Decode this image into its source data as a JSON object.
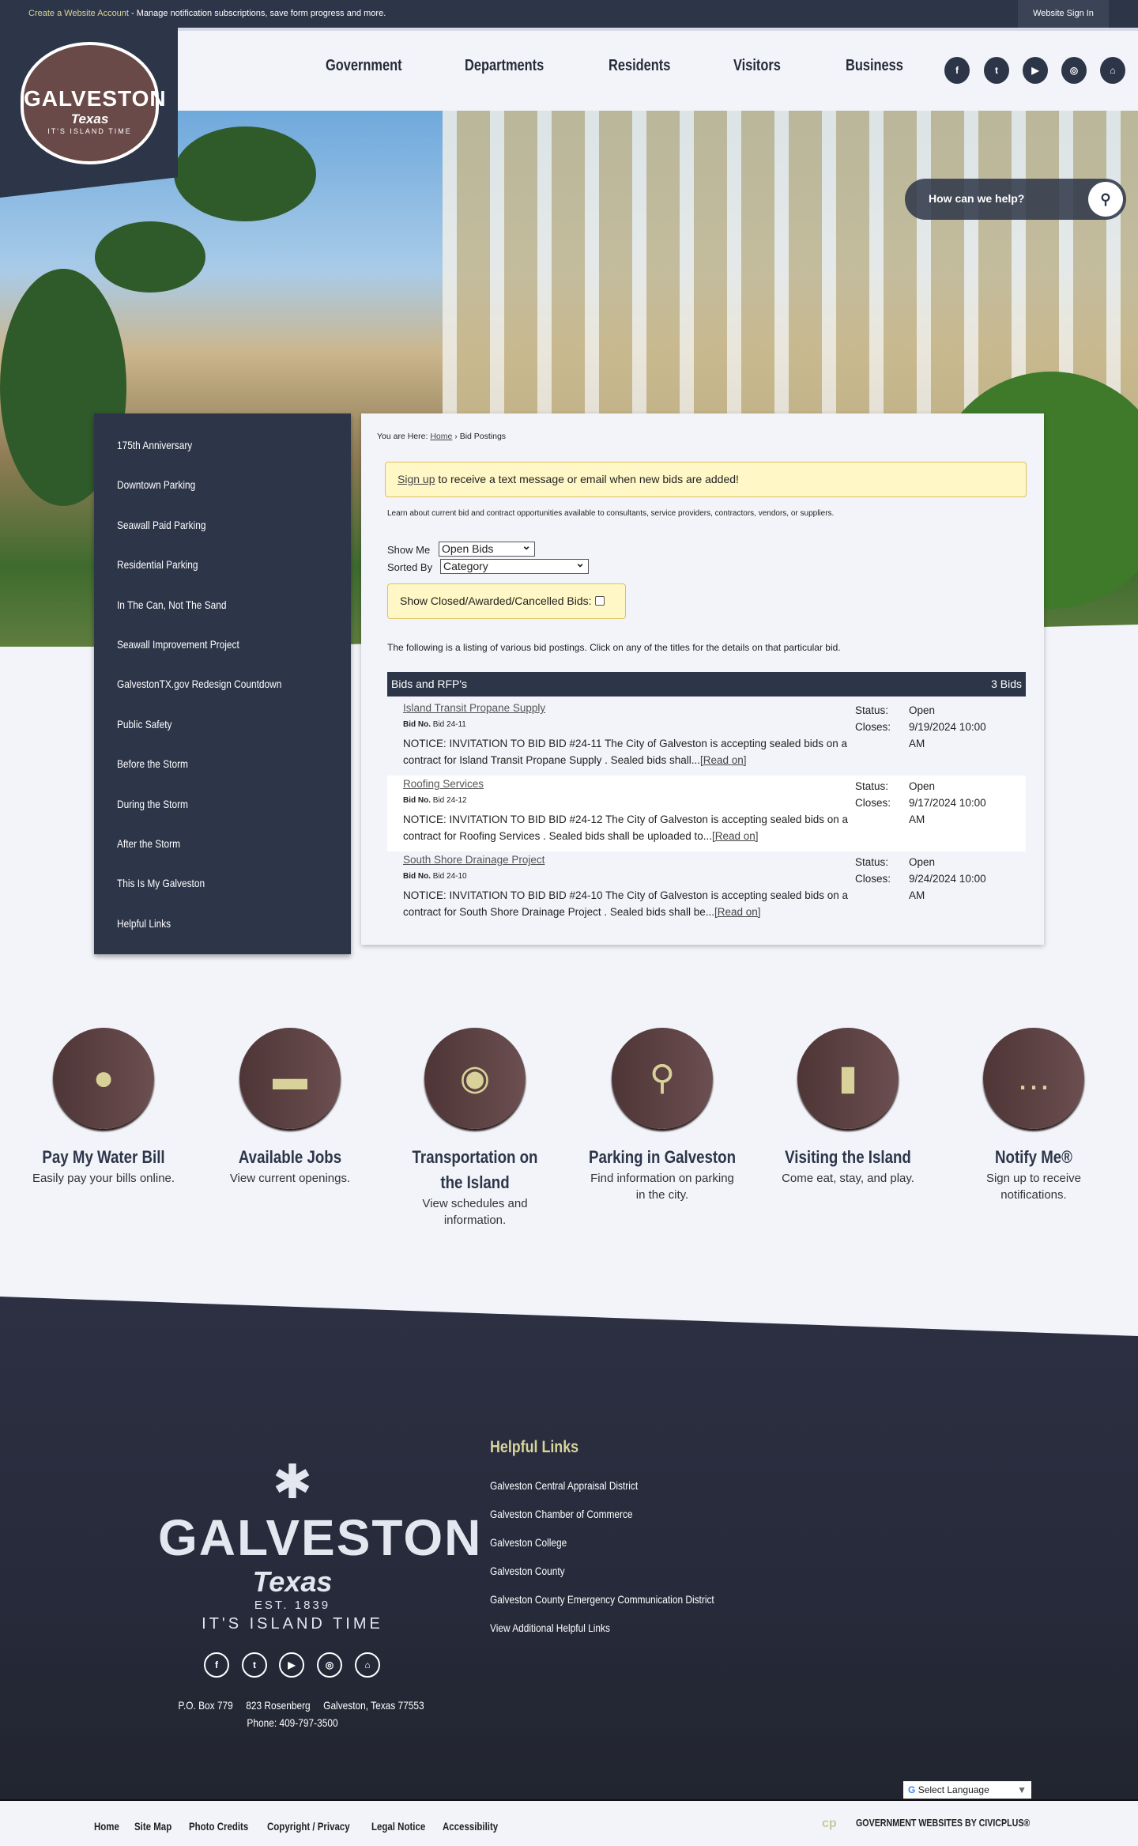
{
  "topbar": {
    "account_link": "Create a Website Account",
    "account_msg": " - Manage notification subscriptions, save form progress and more.",
    "sign_in": "Website Sign In"
  },
  "logo": {
    "name": "GALVESTON",
    "state": "Texas",
    "est": "EST. 1839",
    "tagline": "IT'S ISLAND TIME"
  },
  "nav": {
    "items": [
      "Government",
      "Departments",
      "Residents",
      "Visitors",
      "Business"
    ]
  },
  "social": {
    "icons": [
      "facebook-icon",
      "twitter-icon",
      "youtube-icon",
      "instagram-icon",
      "home-icon"
    ]
  },
  "search": {
    "placeholder": "How can we help?"
  },
  "sidebar": {
    "items": [
      "175th Anniversary",
      "Downtown Parking",
      "Seawall Paid Parking",
      "Residential Parking",
      "In The Can, Not The Sand",
      "Seawall Improvement Project",
      "GalvestonTX.gov Redesign Countdown",
      "Public Safety",
      "Before the Storm",
      "During the Storm",
      "After the Storm",
      "This Is My Galveston",
      "Helpful Links"
    ]
  },
  "content": {
    "breadcrumb": {
      "prefix": "You are Here: ",
      "home": "Home",
      "sep": " › ",
      "current": "Bid Postings"
    },
    "notice": {
      "link": "Sign up",
      "text": " to receive a text message or email when new bids are added!"
    },
    "intro": "Learn about current bid and contract opportunities available to consultants, service providers, contractors, vendors, or suppliers.",
    "show_me_label": "Show Me",
    "show_me_value": "Open Bids",
    "sorted_by_label": "Sorted By",
    "sorted_by_value": "Category",
    "closed_label": "Show Closed/Awarded/Cancelled Bids:",
    "listing_text": "The following is a listing of various bid postings. Click on any of the titles for the details on that particular bid.",
    "table": {
      "title": "Bids and RFP's",
      "count": "3 Bids",
      "bid_no_label": "Bid No.",
      "status_label": "Status:",
      "closes_label": "Closes:",
      "read_on": "[Read on]",
      "bids": [
        {
          "title": "Island Transit Propane Supply",
          "no": "Bid 24-11",
          "desc": "NOTICE: INVITATION TO BID BID #24-11 The City of Galveston is accepting sealed bids on a contract for Island Transit Propane Supply . Sealed bids shall...",
          "status": "Open",
          "closes": "9/19/2024 10:00 AM"
        },
        {
          "title": "Roofing Services",
          "no": "Bid 24-12",
          "desc": "NOTICE: INVITATION TO BID BID #24-12 The City of Galveston is accepting sealed bids on a contract for Roofing Services . Sealed bids shall be uploaded to...",
          "status": "Open",
          "closes": "9/17/2024 10:00 AM"
        },
        {
          "title": "South Shore Drainage Project",
          "no": "Bid 24-10",
          "desc": "NOTICE: INVITATION TO BID BID #24-10 The City of Galveston is accepting sealed bids on a contract for South Shore Drainage Project . Sealed bids shall be...",
          "status": "Open",
          "closes": "9/24/2024 10:00 AM"
        }
      ]
    }
  },
  "quicklinks": [
    {
      "icon": "water-drop-icon",
      "title": "Pay My Water Bill",
      "desc": "Easily pay your bills online."
    },
    {
      "icon": "briefcase-icon",
      "title": "Available Jobs",
      "desc": "View current openings."
    },
    {
      "icon": "car-pin-icon",
      "title": "Transportation on the Island",
      "desc": "View schedules and information."
    },
    {
      "icon": "map-pin-icon",
      "title": "Parking in Galveston",
      "desc": "Find information on parking in the city."
    },
    {
      "icon": "luggage-icon",
      "title": "Visiting the Island",
      "desc": "Come eat, stay, and play."
    },
    {
      "icon": "chat-icon",
      "title": "Notify Me®",
      "desc": "Sign up to receive notifications."
    }
  ],
  "footer": {
    "helpful_title": "Helpful Links",
    "links": [
      "Galveston Central Appraisal District",
      "Galveston Chamber of Commerce",
      "Galveston College",
      "Galveston County",
      "Galveston County Emergency Communication District",
      "View Additional Helpful Links"
    ],
    "address": "P.O. Box 779     823 Rosenberg     Galveston, Texas 77553",
    "phone": "Phone: 409-797-3500",
    "language": "Select Language",
    "bottom_links": [
      "Home",
      "Site Map",
      "Photo Credits",
      "Copyright / Privacy",
      "Legal Notice",
      "Accessibility"
    ],
    "civicplus": "GOVERNMENT WEBSITES BY CIVICPLUS®"
  },
  "colors": {
    "navy": "#2d3548",
    "brown": "#5e4142",
    "gold": "#d8d59a",
    "notice_bg": "#fff7c6"
  }
}
